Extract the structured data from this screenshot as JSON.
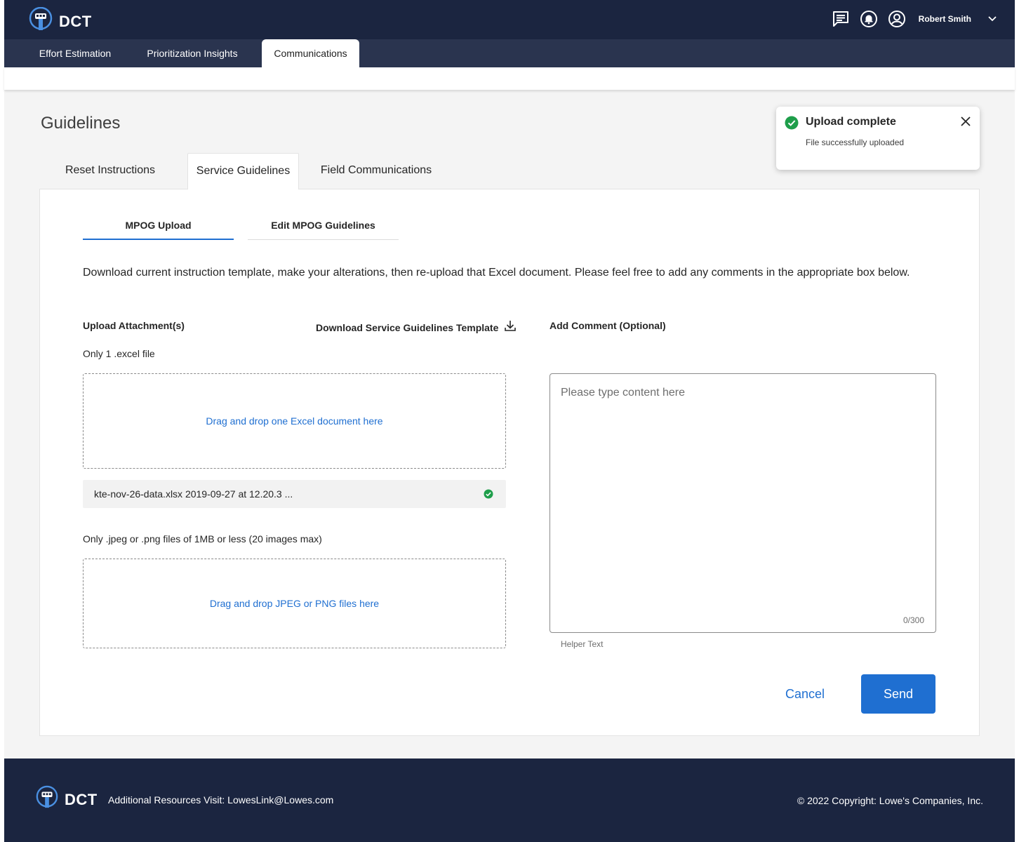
{
  "header": {
    "app_name": "DCT",
    "user_name": "Robert Smith",
    "icons": [
      "chat-icon",
      "bell-icon",
      "account-icon",
      "chevron-down-icon"
    ]
  },
  "nav": {
    "tabs": [
      {
        "label": "Effort Estimation"
      },
      {
        "label": "Prioritization Insights"
      },
      {
        "label": "Communications",
        "active": true
      }
    ]
  },
  "page": {
    "title": "Guidelines",
    "tabs": [
      {
        "label": "Reset Instructions"
      },
      {
        "label": "Service Guidelines",
        "active": true
      },
      {
        "label": "Field Communications"
      }
    ],
    "subtabs": [
      {
        "label": "MPOG Upload",
        "active": true
      },
      {
        "label": "Edit MPOG Guidelines"
      }
    ],
    "description": "Download current instruction template, make your alterations, then re-upload that Excel document. Please feel free to add any comments in the appropriate box below."
  },
  "upload": {
    "title": "Upload Attachment(s)",
    "excel_note": "Only 1  .excel file",
    "excel_drop_label": "Drag and drop one Excel document here",
    "uploaded_file": "kte-nov-26-data.xlsx 2019-09-27 at 12.20.3 ...",
    "image_note": "Only .jpeg or .png files of 1MB or less (20 images max)",
    "image_drop_label": "Drag and drop JPEG or PNG files here",
    "download_label": "Download Service Guidelines Template"
  },
  "comment": {
    "title": "Add Comment (Optional)",
    "placeholder": "Please type content here",
    "counter": "0/300",
    "helper": "Helper Text"
  },
  "actions": {
    "cancel": "Cancel",
    "send": "Send"
  },
  "toast": {
    "title": "Upload complete",
    "body": "File successfully uploaded"
  },
  "footer": {
    "app_name": "DCT",
    "resources": "Additional Resources Visit: LowesLink@Lowes.com",
    "copyright": "© 2022 Copyright: Lowe's Companies, Inc."
  },
  "colors": {
    "header_bg": "#1b2540",
    "nav_bg": "#2a344f",
    "accent": "#1f6fd1",
    "success": "#1e9e4a"
  }
}
